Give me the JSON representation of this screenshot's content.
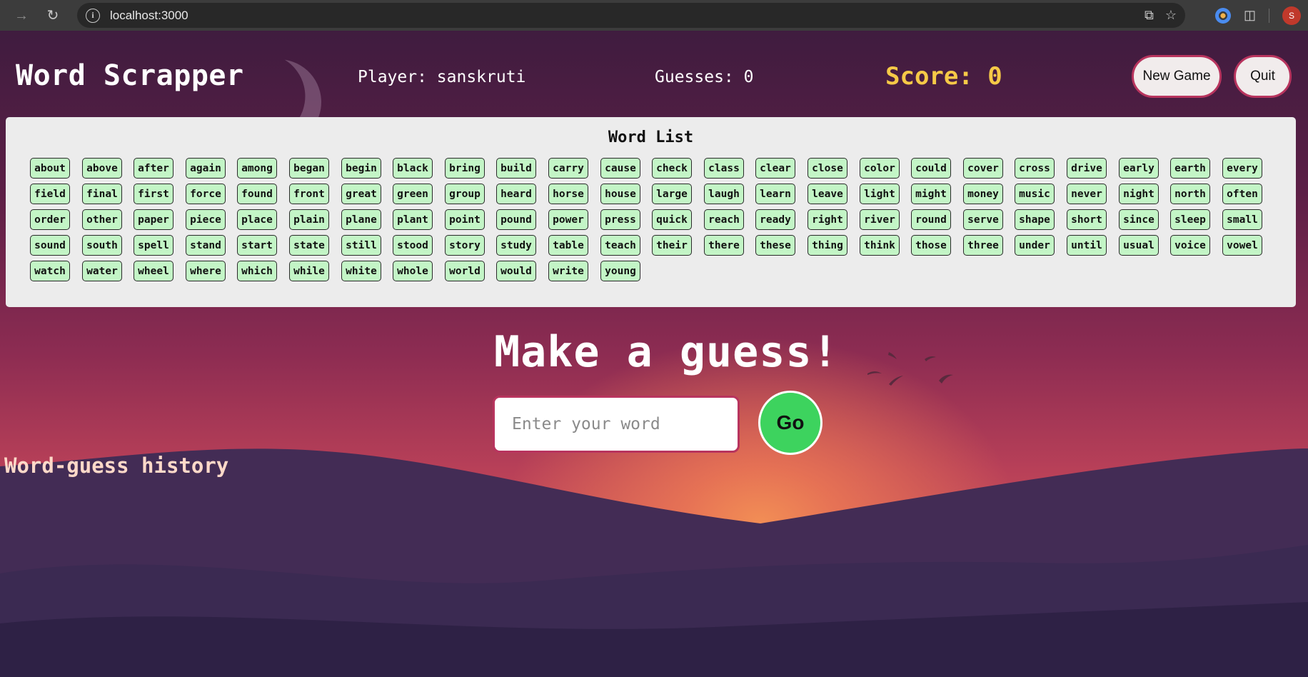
{
  "browser": {
    "url": "localhost:3000",
    "profile_initial": "S",
    "icons": [
      "forward-icon",
      "reload-icon",
      "site-info-icon",
      "open-in-app-icon",
      "bookmark-star-icon",
      "extension-icon",
      "puzzle-extensions-icon",
      "profile-avatar"
    ]
  },
  "header": {
    "title": "Word Scrapper",
    "player": "Player: sanskruti",
    "guesses": "Guesses: 0",
    "score": "Score: 0",
    "new_game_label": "New Game",
    "quit_label": "Quit"
  },
  "word_list": {
    "title": "Word List",
    "words": [
      "about",
      "above",
      "after",
      "again",
      "among",
      "began",
      "begin",
      "black",
      "bring",
      "build",
      "carry",
      "cause",
      "check",
      "class",
      "clear",
      "close",
      "color",
      "could",
      "cover",
      "cross",
      "drive",
      "early",
      "earth",
      "every",
      "field",
      "final",
      "first",
      "force",
      "found",
      "front",
      "great",
      "green",
      "group",
      "heard",
      "horse",
      "house",
      "large",
      "laugh",
      "learn",
      "leave",
      "light",
      "might",
      "money",
      "music",
      "never",
      "night",
      "north",
      "often",
      "order",
      "other",
      "paper",
      "piece",
      "place",
      "plain",
      "plane",
      "plant",
      "point",
      "pound",
      "power",
      "press",
      "quick",
      "reach",
      "ready",
      "right",
      "river",
      "round",
      "serve",
      "shape",
      "short",
      "since",
      "sleep",
      "small",
      "sound",
      "south",
      "spell",
      "stand",
      "start",
      "state",
      "still",
      "stood",
      "story",
      "study",
      "table",
      "teach",
      "their",
      "there",
      "these",
      "thing",
      "think",
      "those",
      "three",
      "under",
      "until",
      "usual",
      "voice",
      "vowel",
      "watch",
      "water",
      "wheel",
      "where",
      "which",
      "while",
      "white",
      "whole",
      "world",
      "would",
      "write",
      "young"
    ]
  },
  "guess": {
    "heading": "Make a guess!",
    "input_placeholder": "Enter your word",
    "input_value": "",
    "go_label": "Go"
  },
  "history": {
    "title": "Word-guess history"
  },
  "colors": {
    "score": "#f6c947",
    "chip_bg": "#c3f5c6",
    "button_border": "#b8345e",
    "go_button": "#3dd35e"
  }
}
